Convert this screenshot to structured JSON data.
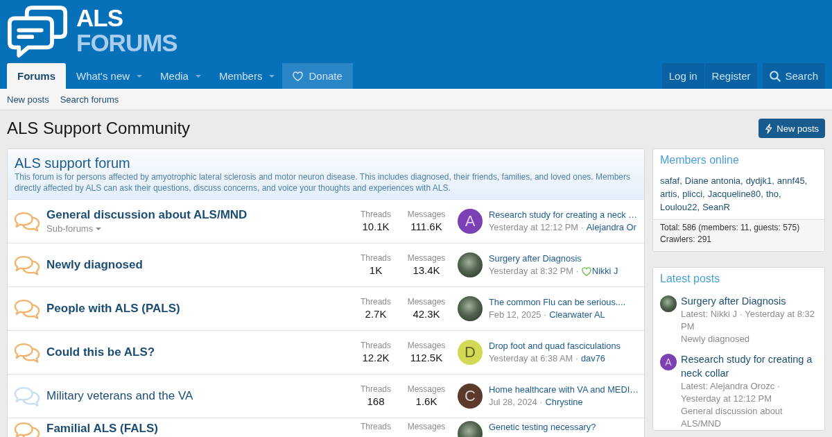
{
  "header": {
    "logo": {
      "line_1": "ALS",
      "line_2": "FORUMS"
    }
  },
  "nav": {
    "tabs": [
      {
        "label": "Forums",
        "selected": true,
        "menu": false,
        "kind": "tab"
      },
      {
        "label": "What's new",
        "selected": false,
        "menu": true,
        "kind": "tab"
      },
      {
        "label": "Media",
        "selected": false,
        "menu": true,
        "kind": "tab"
      },
      {
        "label": "Members",
        "selected": false,
        "menu": true,
        "kind": "tab"
      },
      {
        "label": "Donate",
        "selected": false,
        "menu": false,
        "kind": "donate"
      }
    ],
    "account": [
      {
        "label": "Log in"
      },
      {
        "label": "Register"
      }
    ],
    "search": {
      "label": "Search"
    }
  },
  "sub_nav": [
    {
      "label": "New posts"
    },
    {
      "label": "Search forums"
    }
  ],
  "page": {
    "title": "ALS Support Community",
    "button": "New posts"
  },
  "category": {
    "title": "ALS support forum",
    "description": "This forum is for persons affected by amyotrophic lateral sclerosis and motor neuron disease. This includes diagnosed, their friends, families, and loved ones. Members directly affected by ALS can ask their questions, discuss concerns, and voice your thoughts and experiences with ALS."
  },
  "forums": [
    {
      "title": "General discussion about ALS/MND",
      "unread": true,
      "subforums": "Sub-forums",
      "stats": [
        {
          "label": "Threads",
          "value": "10.1K"
        },
        {
          "label": "Messages",
          "value": "111.6K"
        }
      ],
      "last_post": {
        "title": "Research study for creating a neck …",
        "date": "Yesterday at 12:12 PM ·",
        "author": "Alejandra Or",
        "heart": false,
        "avatar": {
          "kind": "letter",
          "letter": "A",
          "color": "#7b40b3"
        }
      }
    },
    {
      "title": "Newly diagnosed",
      "unread": true,
      "stats": [
        {
          "label": "Threads",
          "value": "1K"
        },
        {
          "label": "Messages",
          "value": "13.4K"
        }
      ],
      "last_post": {
        "title": "Surgery after Diagnosis",
        "date": "Yesterday at 8:32 PM ·",
        "author": "Nikki J",
        "heart": true,
        "avatar": {
          "kind": "photo"
        }
      }
    },
    {
      "title": "People with ALS (PALS)",
      "unread": true,
      "stats": [
        {
          "label": "Threads",
          "value": "2.7K"
        },
        {
          "label": "Messages",
          "value": "42.3K"
        }
      ],
      "last_post": {
        "title": "The common Flu can be serious....",
        "date": "Feb 12, 2025 ·",
        "author": "Clearwater AL",
        "heart": false,
        "avatar": {
          "kind": "photo"
        }
      }
    },
    {
      "title": "Could this be ALS?",
      "unread": true,
      "stats": [
        {
          "label": "Threads",
          "value": "12.2K"
        },
        {
          "label": "Messages",
          "value": "112.5K"
        }
      ],
      "last_post": {
        "title": "Drop foot and quad fasciculations",
        "date": "Yesterday at 6:38 AM ·",
        "author": "dav76",
        "heart": false,
        "avatar": {
          "kind": "letter",
          "letter": "D",
          "color": "#d3d957"
        }
      }
    },
    {
      "title": "Military veterans and the VA",
      "unread": false,
      "stats": [
        {
          "label": "Threads",
          "value": "168"
        },
        {
          "label": "Messages",
          "value": "1.6K"
        }
      ],
      "last_post": {
        "title": "Home healthcare with VA and MEDI…",
        "date": "Jul 28, 2024 ·",
        "author": "Chrystine",
        "heart": false,
        "avatar": {
          "kind": "letter",
          "letter": "C",
          "color": "#5c3a2b"
        }
      }
    },
    {
      "title": "Familial ALS (FALS)",
      "unread": true,
      "stats": [
        {
          "label": "Threads"
        },
        {
          "label": "Messages"
        }
      ],
      "last_post": {
        "title": "Genetic testing necessary?",
        "avatar": {
          "kind": "photo"
        }
      }
    }
  ],
  "sidebar": {
    "members_online": {
      "title": "Members online",
      "names": [
        "safaf,",
        "Diane antonia,",
        "dydjk1,",
        "annf45,",
        "artis,",
        "plicci,",
        "Jacqueline80,",
        "tho,",
        "Loulou22,",
        "SeanR"
      ],
      "total": "Total: 586 (members: 11, guests: 575)",
      "crawlers": "Crawlers: 291"
    },
    "latest_posts": {
      "title": "Latest posts",
      "items": [
        {
          "title": "Surgery after Diagnosis",
          "meta": "Latest: Nikki J · Yesterday at 8:32 PM",
          "forum": "Newly diagnosed",
          "avatar": {
            "kind": "photo"
          }
        },
        {
          "title": "Research study for creating a neck collar",
          "meta": "Latest: Alejandra Orozc · Yesterday at 12:12 PM",
          "forum": "General discussion about ALS/MND",
          "avatar": {
            "kind": "letter",
            "letter": "A",
            "color": "#7b40b3"
          }
        }
      ]
    }
  }
}
